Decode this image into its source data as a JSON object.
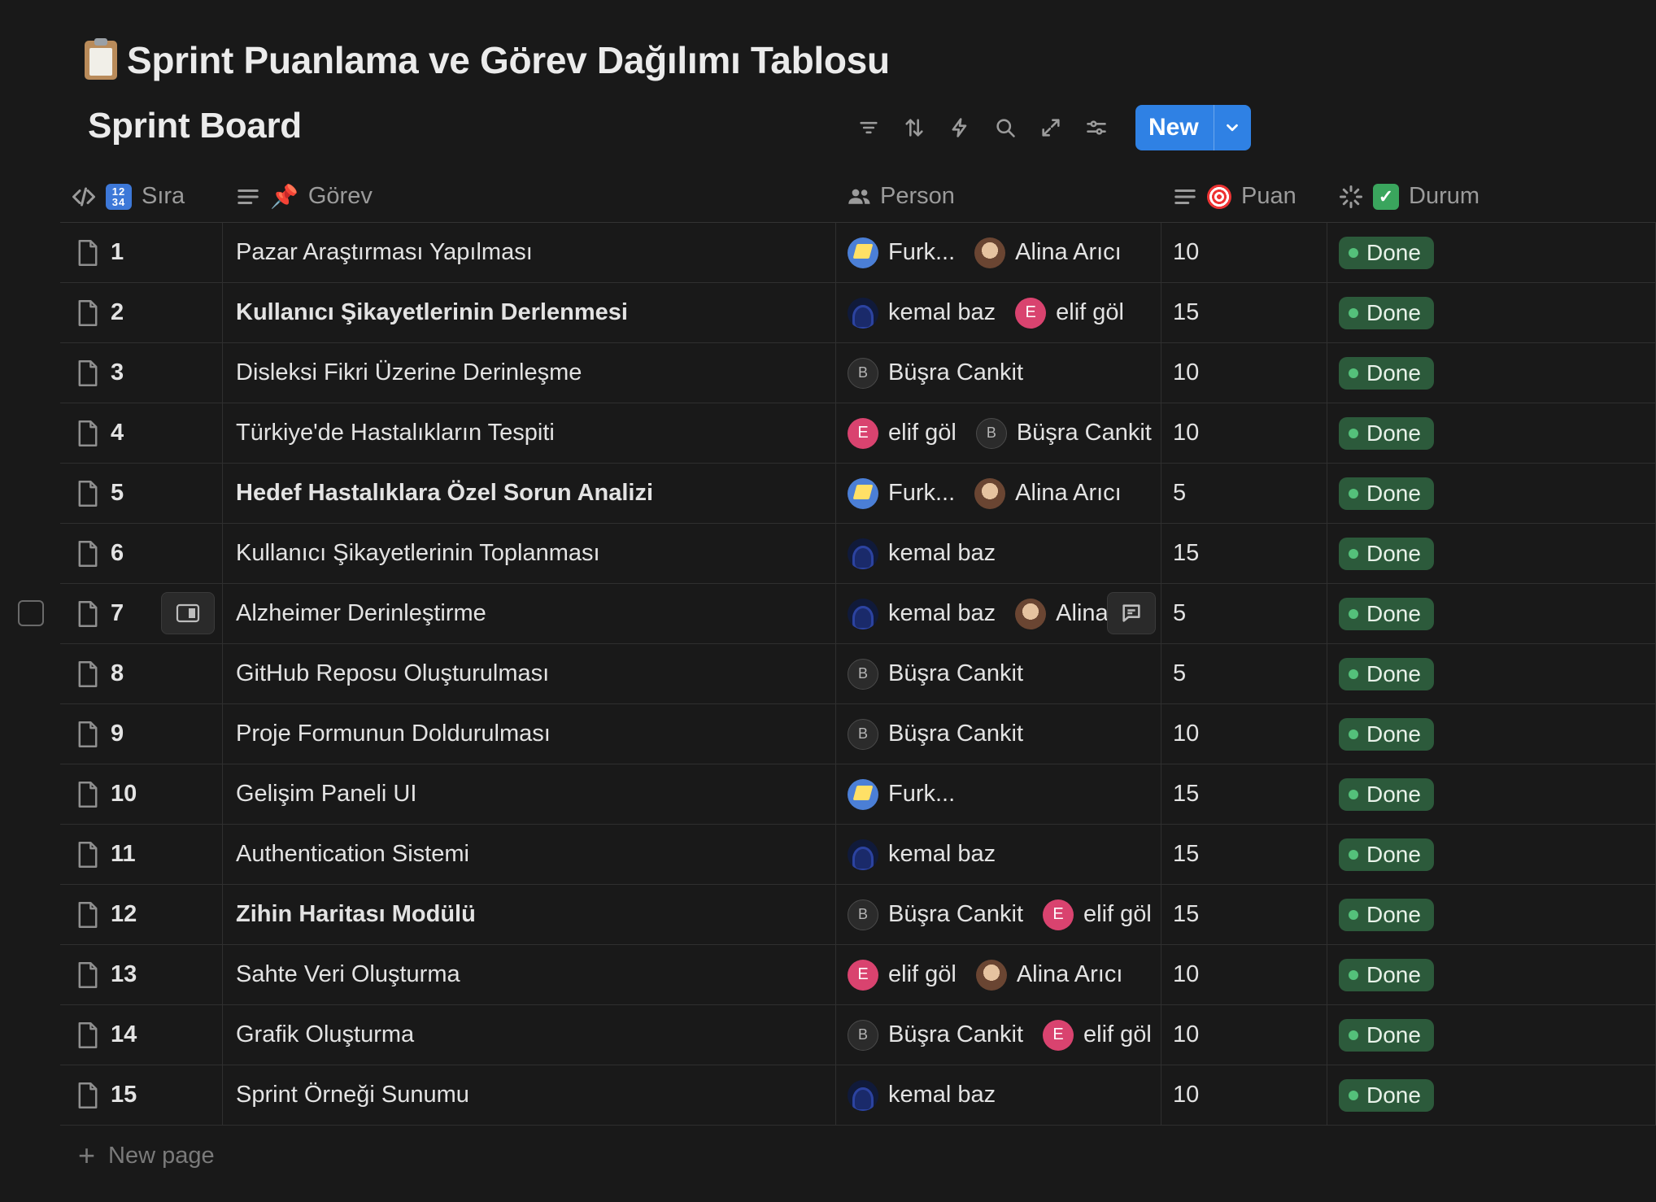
{
  "document": {
    "title": "Sprint Puanlama ve Görev Dağılımı Tablosu",
    "icon": "clipboard-icon"
  },
  "view": {
    "name": "Sprint Board",
    "toolbar": {
      "icons": [
        "filter-icon",
        "sort-icon",
        "automation-icon",
        "search-icon",
        "expand-icon",
        "settings-icon"
      ],
      "new_label": "New",
      "accent": "#2f81e4"
    }
  },
  "columns": [
    {
      "key": "sira",
      "label": "Sıra",
      "emoji": "1234"
    },
    {
      "key": "gorev",
      "label": "Görev",
      "emoji": "📌"
    },
    {
      "key": "person",
      "label": "Person"
    },
    {
      "key": "puan",
      "label": "Puan",
      "emoji": "🎯"
    },
    {
      "key": "durum",
      "label": "Durum",
      "emoji": "✅"
    }
  ],
  "rows": [
    {
      "sira": "1",
      "gorev": "Pazar Araştırması Yapılması",
      "bold": false,
      "people": [
        {
          "name": "Furk...",
          "avatar": "f"
        },
        {
          "name": "Alina Arıcı",
          "avatar": "a"
        }
      ],
      "puan": "10",
      "durum": "Done"
    },
    {
      "sira": "2",
      "gorev": "Kullanıcı Şikayetlerinin Derlenmesi",
      "bold": true,
      "people": [
        {
          "name": "kemal baz",
          "avatar": "k"
        },
        {
          "name": "elif göl",
          "avatar": "e",
          "initial": "E"
        }
      ],
      "puan": "15",
      "durum": "Done"
    },
    {
      "sira": "3",
      "gorev": "Disleksi Fikri Üzerine Derinleşme",
      "bold": false,
      "people": [
        {
          "name": "Büşra Cankit",
          "avatar": "b",
          "initial": "B"
        }
      ],
      "puan": "10",
      "durum": "Done"
    },
    {
      "sira": "4",
      "gorev": "Türkiye'de Hastalıkların Tespiti",
      "bold": false,
      "people": [
        {
          "name": "elif göl",
          "avatar": "e",
          "initial": "E"
        },
        {
          "name": "Büşra Cankit",
          "avatar": "b",
          "initial": "B"
        }
      ],
      "puan": "10",
      "durum": "Done"
    },
    {
      "sira": "5",
      "gorev": "Hedef Hastalıklara Özel Sorun Analizi",
      "bold": true,
      "people": [
        {
          "name": "Furk...",
          "avatar": "f"
        },
        {
          "name": "Alina Arıcı",
          "avatar": "a"
        }
      ],
      "puan": "5",
      "durum": "Done"
    },
    {
      "sira": "6",
      "gorev": "Kullanıcı Şikayetlerinin Toplanması",
      "bold": false,
      "people": [
        {
          "name": "kemal baz",
          "avatar": "k"
        }
      ],
      "puan": "15",
      "durum": "Done"
    },
    {
      "sira": "7",
      "gorev": "Alzheimer Derinleştirme",
      "bold": false,
      "people": [
        {
          "name": "kemal baz",
          "avatar": "k"
        },
        {
          "name": "Alina",
          "avatar": "a"
        }
      ],
      "puan": "5",
      "durum": "Done",
      "hovered": true
    },
    {
      "sira": "8",
      "gorev": "GitHub Reposu Oluşturulması",
      "bold": false,
      "people": [
        {
          "name": "Büşra Cankit",
          "avatar": "b",
          "initial": "B"
        }
      ],
      "puan": "5",
      "durum": "Done"
    },
    {
      "sira": "9",
      "gorev": "Proje Formunun Doldurulması",
      "bold": false,
      "people": [
        {
          "name": "Büşra Cankit",
          "avatar": "b",
          "initial": "B"
        }
      ],
      "puan": "10",
      "durum": "Done"
    },
    {
      "sira": "10",
      "gorev": "Gelişim Paneli UI",
      "bold": false,
      "people": [
        {
          "name": "Furk...",
          "avatar": "f"
        }
      ],
      "puan": "15",
      "durum": "Done"
    },
    {
      "sira": "11",
      "gorev": "Authentication Sistemi",
      "bold": false,
      "people": [
        {
          "name": "kemal baz",
          "avatar": "k"
        }
      ],
      "puan": "15",
      "durum": "Done"
    },
    {
      "sira": "12",
      "gorev": "Zihin Haritası Modülü",
      "bold": true,
      "people": [
        {
          "name": "Büşra Cankit",
          "avatar": "b",
          "initial": "B"
        },
        {
          "name": "elif göl",
          "avatar": "e",
          "initial": "E"
        }
      ],
      "puan": "15",
      "durum": "Done"
    },
    {
      "sira": "13",
      "gorev": "Sahte Veri Oluşturma",
      "bold": false,
      "people": [
        {
          "name": "elif göl",
          "avatar": "e",
          "initial": "E"
        },
        {
          "name": "Alina Arıcı",
          "avatar": "a"
        }
      ],
      "puan": "10",
      "durum": "Done"
    },
    {
      "sira": "14",
      "gorev": "Grafik Oluşturma",
      "bold": false,
      "people": [
        {
          "name": "Büşra Cankit",
          "avatar": "b",
          "initial": "B"
        },
        {
          "name": "elif göl",
          "avatar": "e",
          "initial": "E"
        }
      ],
      "puan": "10",
      "durum": "Done"
    },
    {
      "sira": "15",
      "gorev": "Sprint Örneği Sunumu",
      "bold": false,
      "people": [
        {
          "name": "kemal baz",
          "avatar": "k"
        }
      ],
      "puan": "10",
      "durum": "Done"
    }
  ],
  "footer": {
    "new_page_label": "New page"
  },
  "colors": {
    "background": "#191919",
    "status_done_bg": "#2c5a3b",
    "status_done_dot": "#54c07a"
  }
}
